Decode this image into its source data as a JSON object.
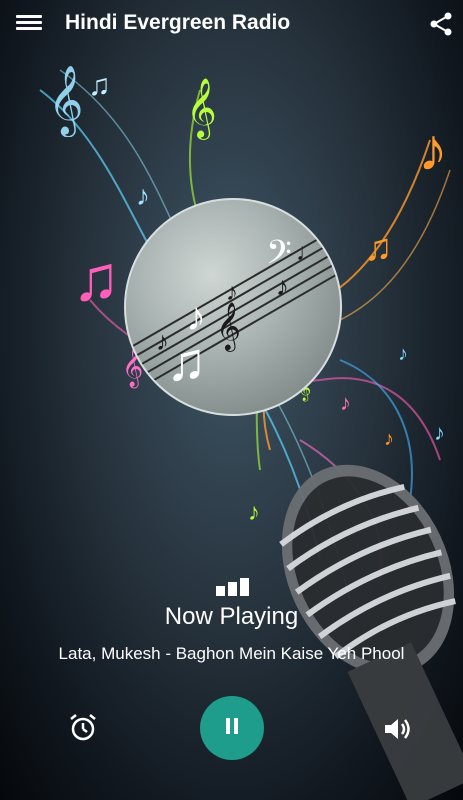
{
  "app": {
    "title": "Hindi Evergreen Radio"
  },
  "icons": {
    "menu": "menu-icon",
    "share": "share-icon",
    "equalizer": "equalizer-icon",
    "alarm": "alarm-icon",
    "pause": "pause-icon",
    "volume": "volume-icon"
  },
  "player": {
    "status": "Now Playing",
    "track": "Lata, Mukesh - Baghon Mein Kaise Yeh Phool"
  },
  "colors": {
    "accent": "#1e9c8c",
    "text": "#ffffff"
  }
}
